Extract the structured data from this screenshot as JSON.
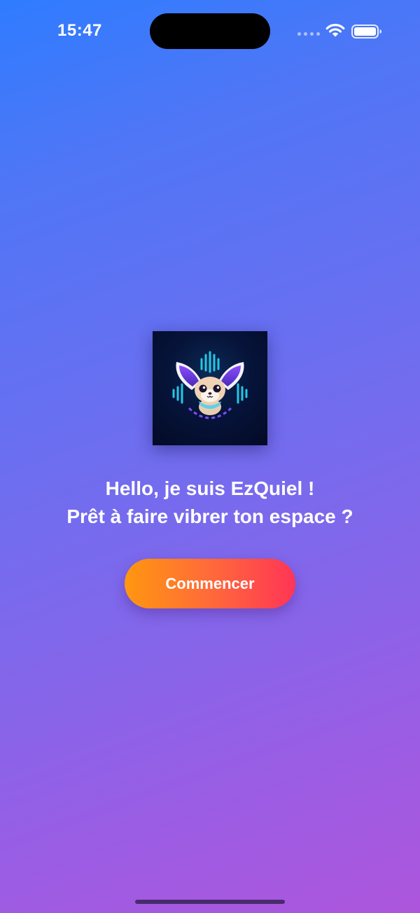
{
  "status_bar": {
    "time": "15:47",
    "icons": [
      "signal-dots-icon",
      "wifi-icon",
      "battery-icon"
    ]
  },
  "app": {
    "logo": "fennec-fox-logo",
    "greeting_line1": "Hello, je suis EzQuiel !",
    "greeting_line2": "Prêt à faire vibrer ton espace ?",
    "start_button_label": "Commencer"
  },
  "colors": {
    "background_top": "#2f7cff",
    "background_bottom": "#ad56dc",
    "button_left": "#ff9710",
    "button_right": "#ff3556"
  }
}
